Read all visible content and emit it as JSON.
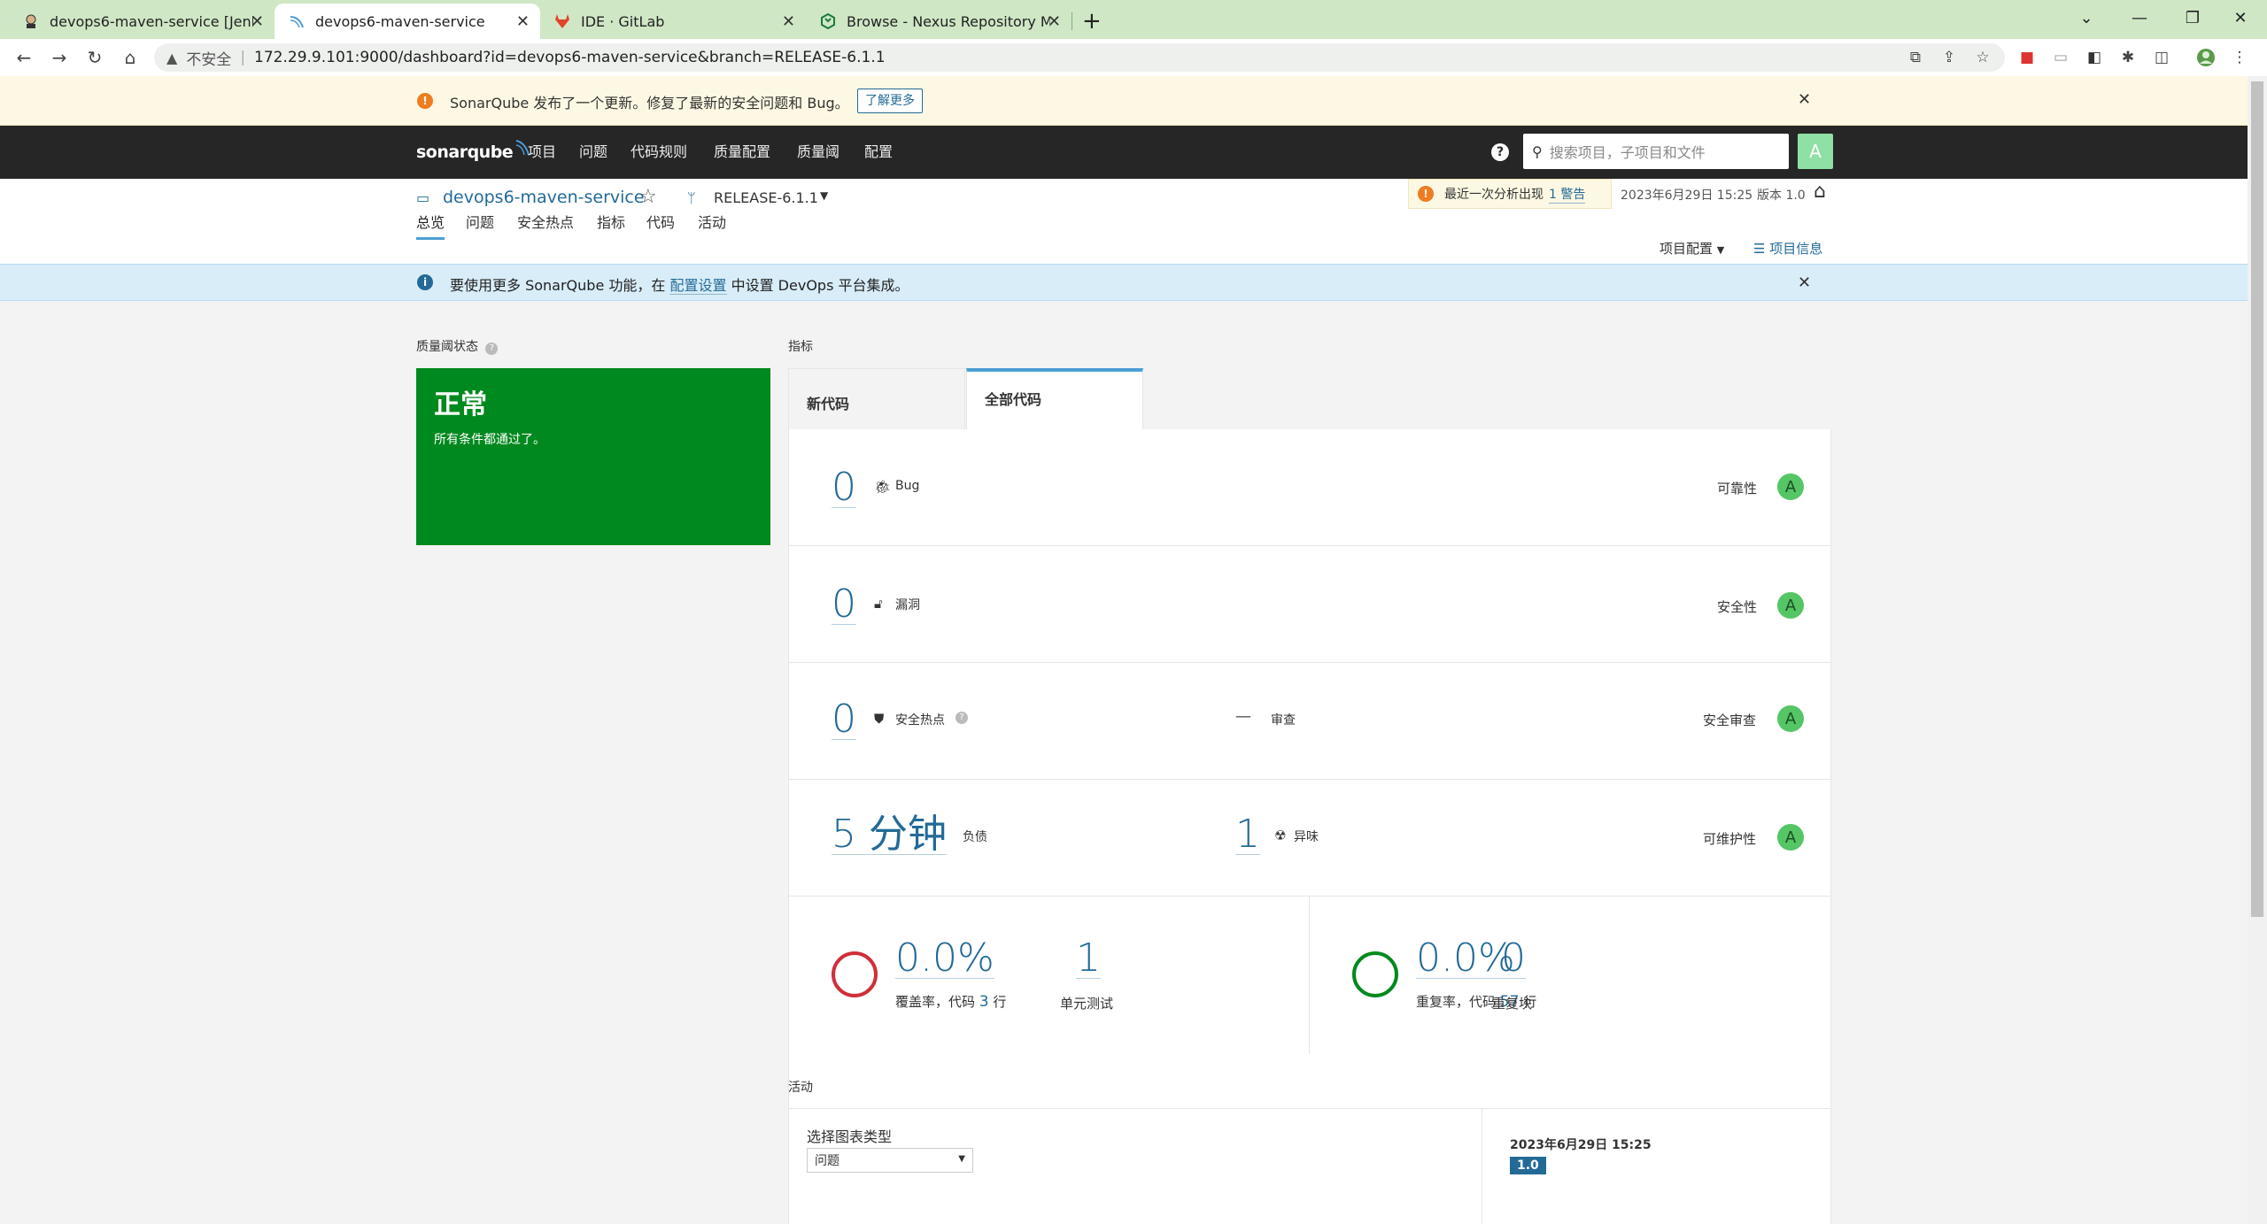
{
  "browser": {
    "tabs": [
      {
        "title": "devops6-maven-service [Jenkins]",
        "active": false
      },
      {
        "title": "devops6-maven-service",
        "active": true
      },
      {
        "title": "IDE · GitLab",
        "active": false
      },
      {
        "title": "Browse - Nexus Repository Manager",
        "active": false
      }
    ],
    "new_tab": "+",
    "security_label": "不安全",
    "url": "172.29.9.101:9000/dashboard?id=devops6-maven-service&branch=RELEASE-6.1.1"
  },
  "update_banner": {
    "text": "SonarQube 发布了一个更新。修复了最新的安全问题和 Bug。",
    "button": "了解更多"
  },
  "topnav": {
    "logo": "sonarqube",
    "items": [
      "项目",
      "问题",
      "代码规则",
      "质量配置",
      "质量阈",
      "配置"
    ],
    "search_placeholder": "搜索项目，子项目和文件",
    "avatar": "A"
  },
  "project": {
    "name": "devops6-maven-service",
    "branch": "RELEASE-6.1.1",
    "warning_prefix": "最近一次分析出现",
    "warning_link": "1 警告",
    "date": "2023年6月29日 15:25",
    "version": "版本 1.0",
    "tabs": [
      "总览",
      "问题",
      "安全热点",
      "指标",
      "代码",
      "活动"
    ],
    "project_config": "项目配置",
    "project_info": "项目信息"
  },
  "info_banner": {
    "before": "要使用更多 SonarQube 功能，在",
    "link": "配置设置",
    "after": "中设置 DevOps 平台集成。"
  },
  "quality_gate": {
    "heading": "质量阈状态",
    "status": "正常",
    "message": "所有条件都通过了。",
    "color": "#00891e"
  },
  "measures": {
    "heading": "指标",
    "tab_new": "新代码",
    "tab_overall": "全部代码",
    "rows": [
      {
        "value": "0",
        "label": "Bug",
        "rating_label": "可靠性",
        "rating": "A"
      },
      {
        "value": "0",
        "label": "漏洞",
        "rating_label": "安全性",
        "rating": "A"
      },
      {
        "value": "0",
        "label": "安全热点",
        "middle_value": "—",
        "middle_label": "审查",
        "rating_label": "安全审查",
        "rating": "A"
      },
      {
        "value": "5 分钟",
        "label": "负债",
        "middle_value": "1",
        "middle_label": "异味",
        "rating_label": "可维护性",
        "rating": "A"
      }
    ],
    "coverage": {
      "value": "0.0%",
      "label_prefix": "覆盖率，代码",
      "lines": "3",
      "label_suffix": "行",
      "tests_value": "1",
      "tests_label": "单元测试"
    },
    "duplications": {
      "value": "0.0%",
      "label_prefix": "重复率，代码",
      "lines": "57",
      "label_suffix": "行",
      "blocks_value": "0",
      "blocks_label": "重复块"
    }
  },
  "activity": {
    "heading": "活动",
    "chart_type_label": "选择图表类型",
    "chart_type_value": "问题",
    "date": "2023年6月29日 15:25",
    "version_badge": "1.0"
  }
}
